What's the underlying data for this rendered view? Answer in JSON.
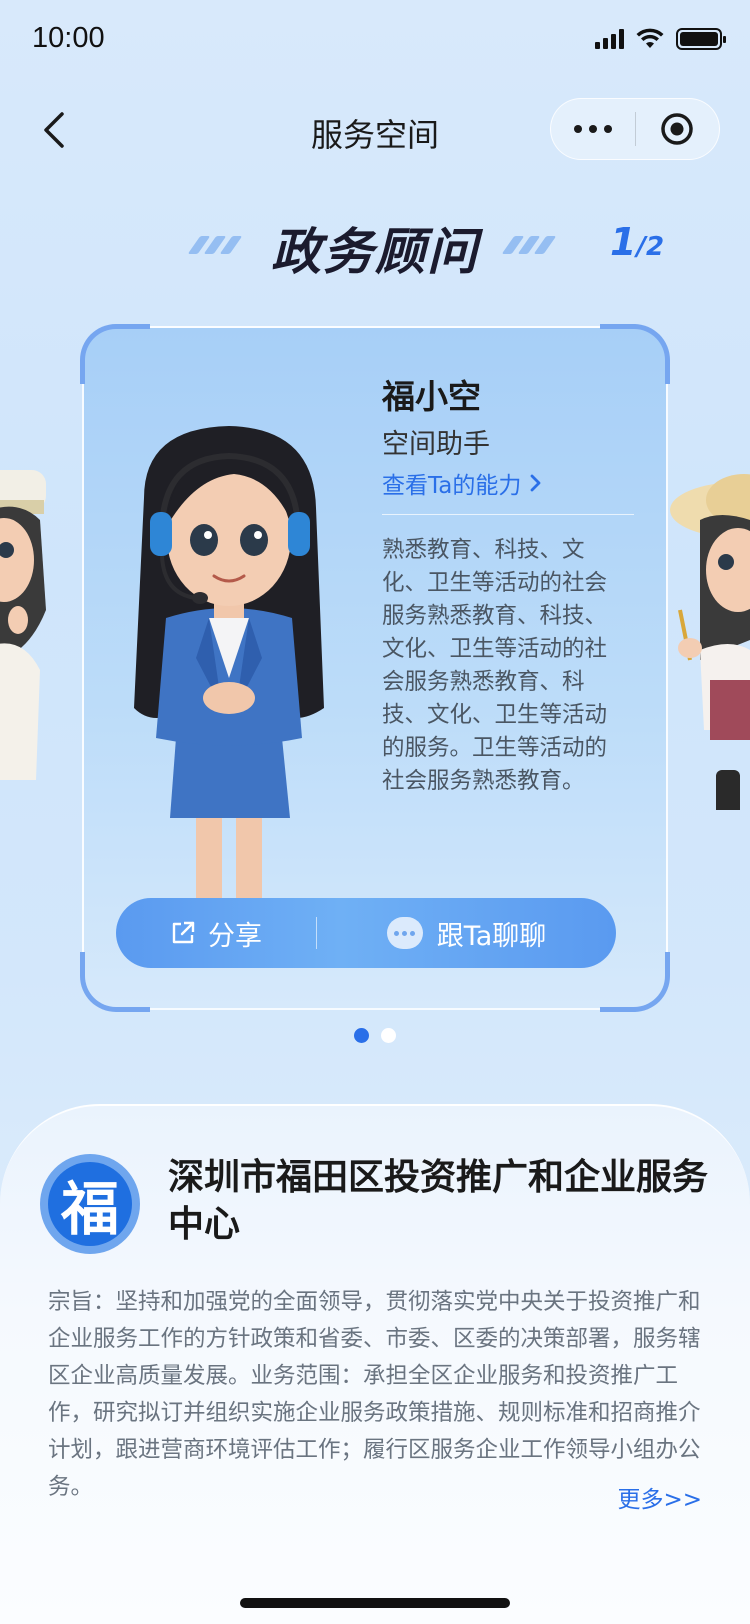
{
  "status_bar": {
    "time": "10:00"
  },
  "nav": {
    "title": "服务空间"
  },
  "section": {
    "title": "政务顾问",
    "page_current": "1",
    "page_total": "/2"
  },
  "card": {
    "name": "福小空",
    "role": "空间助手",
    "ability_link": "查看Ta的能力",
    "description": "熟悉教育、科技、文化、卫生等活动的社会服务熟悉教育、科技、文化、卫生等活动的社会服务熟悉教育、科技、文化、卫生等活动的服务。卫生等活动的社会服务熟悉教育。",
    "share_label": "分享",
    "chat_label": "跟Ta聊聊"
  },
  "pager": {
    "total": 2,
    "active_index": 0
  },
  "org": {
    "logo_char": "福",
    "name": "深圳市福田区投资推广和企业服务中心",
    "description": "宗旨：坚持和加强党的全面领导，贯彻落实党中央关于投资推广和企业服务工作的方针政策和省委、市委、区委的决策部署，服务辖区企业高质量发展。业务范围：承担全区企业服务和投资推广工作，研究拟订并组织实施企业服务政策措施、规则标准和招商推介计划，跟进营商环境评估工作；履行区服务企业工作领导小组办公务。",
    "more_label": "更多>>"
  },
  "colors": {
    "accent": "#2a6fe8",
    "button": "#5a9af0",
    "text_secondary": "#6a7480"
  },
  "icons": [
    "back-icon",
    "more-dots-icon",
    "target-icon",
    "chevron-right-icon",
    "share-icon",
    "chat-bubble-icon"
  ]
}
